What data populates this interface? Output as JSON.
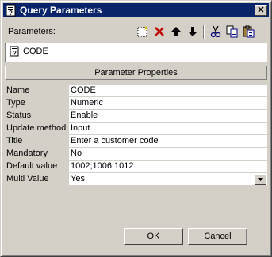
{
  "window": {
    "title": "Query Parameters",
    "icon": "query-parameters-icon",
    "close_glyph": "✕"
  },
  "parameters": {
    "label": "Parameters:",
    "toolbar_icons": [
      "new-icon",
      "delete-icon",
      "move-up-icon",
      "move-down-icon",
      "cut-icon",
      "copy-icon",
      "paste-icon"
    ],
    "items": [
      {
        "name": "CODE",
        "icon": "parameter-icon"
      }
    ]
  },
  "properties": {
    "header": "Parameter Properties",
    "rows": [
      {
        "label": "Name",
        "value": "CODE"
      },
      {
        "label": "Type",
        "value": "Numeric"
      },
      {
        "label": "Status",
        "value": "Enable"
      },
      {
        "label": "Update method",
        "value": "Input"
      },
      {
        "label": "Title",
        "value": "Enter a customer code"
      },
      {
        "label": "Mandatory",
        "value": "No"
      },
      {
        "label": "Default value",
        "value": "1002;1006;1012"
      },
      {
        "label": "Multi Value",
        "value": "Yes"
      }
    ]
  },
  "buttons": {
    "ok": "OK",
    "cancel": "Cancel"
  },
  "colors": {
    "title_bar": "#0a246a",
    "face": "#d4d0c8"
  }
}
